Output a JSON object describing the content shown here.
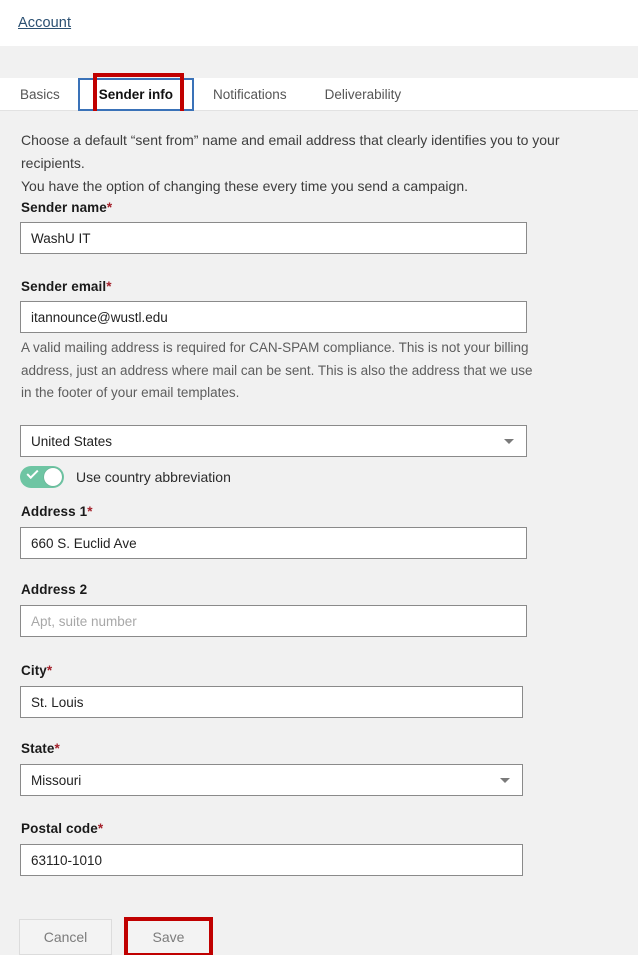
{
  "breadcrumb": {
    "label": "Account"
  },
  "tabs": [
    {
      "label": "Basics",
      "active": false
    },
    {
      "label": "Sender info",
      "active": true
    },
    {
      "label": "Notifications",
      "active": false
    },
    {
      "label": "Deliverability",
      "active": false
    }
  ],
  "intro": {
    "line1": "Choose a default “sent from” name and email address that clearly identifies you to your recipients.",
    "line2": "You have the option of changing these every time you send a campaign."
  },
  "fields": {
    "sender_name": {
      "label": "Sender name",
      "required": "*",
      "value": "WashU IT"
    },
    "sender_email": {
      "label": "Sender email",
      "required": "*",
      "value": "itannounce@wustl.edu",
      "helper": "A valid mailing address is required for CAN-SPAM compliance. This is not your billing address, just an address where mail can be sent. This is also the address that we use in the footer of your email templates."
    },
    "country": {
      "value": "United States"
    },
    "country_abbrev_toggle": {
      "label": "Use country abbreviation",
      "state": "on"
    },
    "address1": {
      "label": "Address 1",
      "required": "*",
      "value": "660 S. Euclid Ave"
    },
    "address2": {
      "label": "Address 2",
      "required": "",
      "placeholder": "Apt, suite number",
      "value": ""
    },
    "city": {
      "label": "City",
      "required": "*",
      "value": "St. Louis"
    },
    "state": {
      "label": "State",
      "required": "*",
      "value": "Missouri"
    },
    "postal_code": {
      "label": "Postal code",
      "required": "*",
      "value": "63110-1010"
    }
  },
  "buttons": {
    "cancel": "Cancel",
    "save": "Save"
  },
  "colors": {
    "page_bg": "#f1f1f1",
    "breadcrumb_link": "#2b5072",
    "active_tab_border": "#3a72b8",
    "annotation_red": "#c00000",
    "required_asterisk": "#a3202a",
    "toggle_on": "#6ec5a3"
  },
  "icons": {
    "caret": "chevron-down-icon",
    "toggle_check": "check-icon"
  }
}
